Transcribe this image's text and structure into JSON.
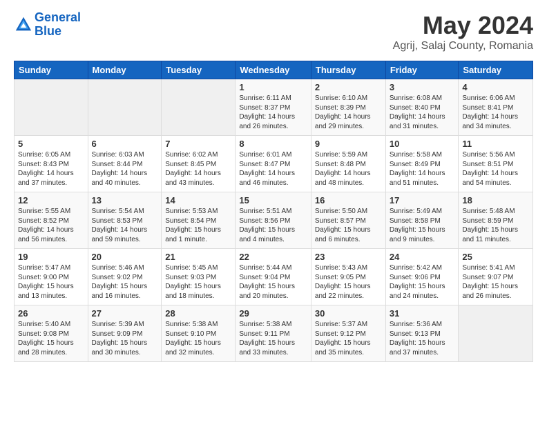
{
  "header": {
    "logo_line1": "General",
    "logo_line2": "Blue",
    "title": "May 2024",
    "subtitle": "Agrij, Salaj County, Romania"
  },
  "weekdays": [
    "Sunday",
    "Monday",
    "Tuesday",
    "Wednesday",
    "Thursday",
    "Friday",
    "Saturday"
  ],
  "weeks": [
    [
      {
        "day": "",
        "sunrise": "",
        "sunset": "",
        "daylight": ""
      },
      {
        "day": "",
        "sunrise": "",
        "sunset": "",
        "daylight": ""
      },
      {
        "day": "",
        "sunrise": "",
        "sunset": "",
        "daylight": ""
      },
      {
        "day": "1",
        "sunrise": "Sunrise: 6:11 AM",
        "sunset": "Sunset: 8:37 PM",
        "daylight": "Daylight: 14 hours and 26 minutes."
      },
      {
        "day": "2",
        "sunrise": "Sunrise: 6:10 AM",
        "sunset": "Sunset: 8:39 PM",
        "daylight": "Daylight: 14 hours and 29 minutes."
      },
      {
        "day": "3",
        "sunrise": "Sunrise: 6:08 AM",
        "sunset": "Sunset: 8:40 PM",
        "daylight": "Daylight: 14 hours and 31 minutes."
      },
      {
        "day": "4",
        "sunrise": "Sunrise: 6:06 AM",
        "sunset": "Sunset: 8:41 PM",
        "daylight": "Daylight: 14 hours and 34 minutes."
      }
    ],
    [
      {
        "day": "5",
        "sunrise": "Sunrise: 6:05 AM",
        "sunset": "Sunset: 8:43 PM",
        "daylight": "Daylight: 14 hours and 37 minutes."
      },
      {
        "day": "6",
        "sunrise": "Sunrise: 6:03 AM",
        "sunset": "Sunset: 8:44 PM",
        "daylight": "Daylight: 14 hours and 40 minutes."
      },
      {
        "day": "7",
        "sunrise": "Sunrise: 6:02 AM",
        "sunset": "Sunset: 8:45 PM",
        "daylight": "Daylight: 14 hours and 43 minutes."
      },
      {
        "day": "8",
        "sunrise": "Sunrise: 6:01 AM",
        "sunset": "Sunset: 8:47 PM",
        "daylight": "Daylight: 14 hours and 46 minutes."
      },
      {
        "day": "9",
        "sunrise": "Sunrise: 5:59 AM",
        "sunset": "Sunset: 8:48 PM",
        "daylight": "Daylight: 14 hours and 48 minutes."
      },
      {
        "day": "10",
        "sunrise": "Sunrise: 5:58 AM",
        "sunset": "Sunset: 8:49 PM",
        "daylight": "Daylight: 14 hours and 51 minutes."
      },
      {
        "day": "11",
        "sunrise": "Sunrise: 5:56 AM",
        "sunset": "Sunset: 8:51 PM",
        "daylight": "Daylight: 14 hours and 54 minutes."
      }
    ],
    [
      {
        "day": "12",
        "sunrise": "Sunrise: 5:55 AM",
        "sunset": "Sunset: 8:52 PM",
        "daylight": "Daylight: 14 hours and 56 minutes."
      },
      {
        "day": "13",
        "sunrise": "Sunrise: 5:54 AM",
        "sunset": "Sunset: 8:53 PM",
        "daylight": "Daylight: 14 hours and 59 minutes."
      },
      {
        "day": "14",
        "sunrise": "Sunrise: 5:53 AM",
        "sunset": "Sunset: 8:54 PM",
        "daylight": "Daylight: 15 hours and 1 minute."
      },
      {
        "day": "15",
        "sunrise": "Sunrise: 5:51 AM",
        "sunset": "Sunset: 8:56 PM",
        "daylight": "Daylight: 15 hours and 4 minutes."
      },
      {
        "day": "16",
        "sunrise": "Sunrise: 5:50 AM",
        "sunset": "Sunset: 8:57 PM",
        "daylight": "Daylight: 15 hours and 6 minutes."
      },
      {
        "day": "17",
        "sunrise": "Sunrise: 5:49 AM",
        "sunset": "Sunset: 8:58 PM",
        "daylight": "Daylight: 15 hours and 9 minutes."
      },
      {
        "day": "18",
        "sunrise": "Sunrise: 5:48 AM",
        "sunset": "Sunset: 8:59 PM",
        "daylight": "Daylight: 15 hours and 11 minutes."
      }
    ],
    [
      {
        "day": "19",
        "sunrise": "Sunrise: 5:47 AM",
        "sunset": "Sunset: 9:00 PM",
        "daylight": "Daylight: 15 hours and 13 minutes."
      },
      {
        "day": "20",
        "sunrise": "Sunrise: 5:46 AM",
        "sunset": "Sunset: 9:02 PM",
        "daylight": "Daylight: 15 hours and 16 minutes."
      },
      {
        "day": "21",
        "sunrise": "Sunrise: 5:45 AM",
        "sunset": "Sunset: 9:03 PM",
        "daylight": "Daylight: 15 hours and 18 minutes."
      },
      {
        "day": "22",
        "sunrise": "Sunrise: 5:44 AM",
        "sunset": "Sunset: 9:04 PM",
        "daylight": "Daylight: 15 hours and 20 minutes."
      },
      {
        "day": "23",
        "sunrise": "Sunrise: 5:43 AM",
        "sunset": "Sunset: 9:05 PM",
        "daylight": "Daylight: 15 hours and 22 minutes."
      },
      {
        "day": "24",
        "sunrise": "Sunrise: 5:42 AM",
        "sunset": "Sunset: 9:06 PM",
        "daylight": "Daylight: 15 hours and 24 minutes."
      },
      {
        "day": "25",
        "sunrise": "Sunrise: 5:41 AM",
        "sunset": "Sunset: 9:07 PM",
        "daylight": "Daylight: 15 hours and 26 minutes."
      }
    ],
    [
      {
        "day": "26",
        "sunrise": "Sunrise: 5:40 AM",
        "sunset": "Sunset: 9:08 PM",
        "daylight": "Daylight: 15 hours and 28 minutes."
      },
      {
        "day": "27",
        "sunrise": "Sunrise: 5:39 AM",
        "sunset": "Sunset: 9:09 PM",
        "daylight": "Daylight: 15 hours and 30 minutes."
      },
      {
        "day": "28",
        "sunrise": "Sunrise: 5:38 AM",
        "sunset": "Sunset: 9:10 PM",
        "daylight": "Daylight: 15 hours and 32 minutes."
      },
      {
        "day": "29",
        "sunrise": "Sunrise: 5:38 AM",
        "sunset": "Sunset: 9:11 PM",
        "daylight": "Daylight: 15 hours and 33 minutes."
      },
      {
        "day": "30",
        "sunrise": "Sunrise: 5:37 AM",
        "sunset": "Sunset: 9:12 PM",
        "daylight": "Daylight: 15 hours and 35 minutes."
      },
      {
        "day": "31",
        "sunrise": "Sunrise: 5:36 AM",
        "sunset": "Sunset: 9:13 PM",
        "daylight": "Daylight: 15 hours and 37 minutes."
      },
      {
        "day": "",
        "sunrise": "",
        "sunset": "",
        "daylight": ""
      }
    ]
  ]
}
